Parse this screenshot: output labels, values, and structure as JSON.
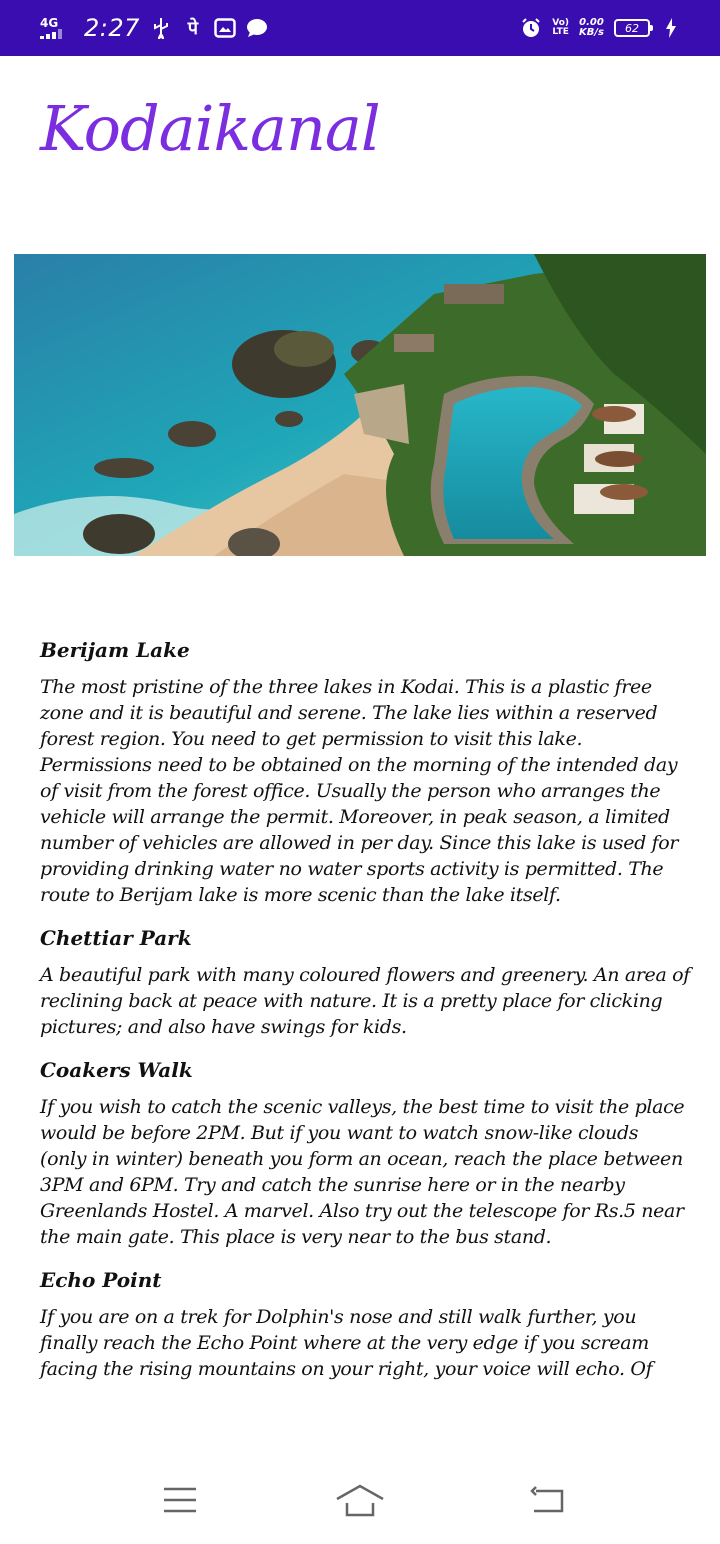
{
  "status_bar": {
    "network": "4G",
    "time": "2:27",
    "hindi_glyph": "पे",
    "volte_top": "Vo)",
    "volte_bottom": "LTE",
    "speed_value": "0.00",
    "speed_unit": "KB/s",
    "battery": "62"
  },
  "app": {
    "title": "Kodaikanal"
  },
  "hero": {
    "colors": {
      "sea": "#1fa7b8",
      "sand": "#e6c7a2",
      "pool": "#1bb0c4",
      "foliage": "#3d6b2a"
    }
  },
  "sections": [
    {
      "title": "Berijam Lake",
      "body": " The most pristine of the three lakes in Kodai. This is a plastic free zone and it is beautiful and serene. The lake lies within a reserved forest region. You need to get permission to visit this lake. Permissions need to be obtained on the morning of the intended day of visit from the forest office. Usually the person who arranges the vehicle will arrange the permit. Moreover, in peak season, a limited number of vehicles are allowed in per day. Since this lake is used for providing drinking water no water sports activity is permitted. The route to Berijam lake is more scenic than the lake itself."
    },
    {
      "title": "Chettiar Park",
      "body": "A beautiful park with many coloured flowers and greenery. An area of reclining back at peace with nature. It is a pretty place for clicking pictures; and also have swings for kids."
    },
    {
      "title": "Coakers Walk",
      "body": "If you wish to catch the scenic valleys, the best time to visit the place would be before 2PM. But if you want to watch snow-like clouds (only in winter) beneath you form an ocean, reach the place between 3PM and 6PM. Try and catch the sunrise here or in the nearby Greenlands Hostel. A marvel. Also try out the telescope for Rs.5 near the main gate. This place is very near to the bus stand."
    },
    {
      "title": "Echo Point",
      "body": " If you are on a trek for Dolphin's nose and still walk further, you finally reach the Echo Point where at the very edge if you scream facing the rising mountains on your right, your voice will echo. Of"
    }
  ],
  "nav": {
    "icons": [
      "menu-icon",
      "home-icon",
      "back-icon"
    ]
  }
}
